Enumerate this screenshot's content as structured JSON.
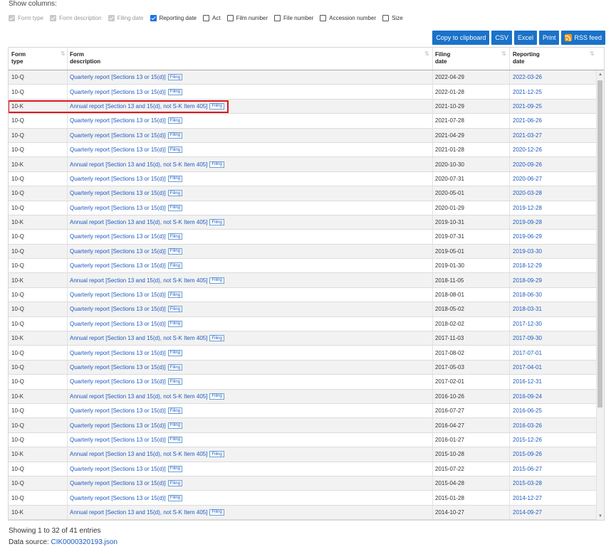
{
  "show_columns": {
    "title": "Show columns:",
    "options": [
      {
        "label": "Form type",
        "checked": true,
        "disabled": true
      },
      {
        "label": "Form description",
        "checked": true,
        "disabled": true
      },
      {
        "label": "Filing date",
        "checked": true,
        "disabled": true
      },
      {
        "label": "Reporting date",
        "checked": true,
        "disabled": false
      },
      {
        "label": "Act",
        "checked": false,
        "disabled": false
      },
      {
        "label": "Film number",
        "checked": false,
        "disabled": false
      },
      {
        "label": "File number",
        "checked": false,
        "disabled": false
      },
      {
        "label": "Accession number",
        "checked": false,
        "disabled": false
      },
      {
        "label": "Size",
        "checked": false,
        "disabled": false
      }
    ]
  },
  "toolbar": {
    "copy_label": "Copy to clipboard",
    "csv_label": "CSV",
    "excel_label": "Excel",
    "print_label": "Print",
    "rss_label": "RSS feed"
  },
  "table": {
    "headers": {
      "form_type": [
        "Form",
        "type"
      ],
      "form_description": [
        "Form",
        "description"
      ],
      "filing_date": [
        "Filing",
        "date"
      ],
      "reporting_date": [
        "Reporting",
        "date"
      ]
    },
    "filing_tag": "Filing",
    "highlighted_row_index": 2,
    "rows": [
      {
        "type": "10-Q",
        "desc": "Quarterly report [Sections 13 or 15(d)]",
        "filing_date": "2022-04-29",
        "reporting_date": "2022-03-26"
      },
      {
        "type": "10-Q",
        "desc": "Quarterly report [Sections 13 or 15(d)]",
        "filing_date": "2022-01-28",
        "reporting_date": "2021-12-25"
      },
      {
        "type": "10-K",
        "desc": "Annual report [Section 13 and 15(d), not S-K Item 405]",
        "filing_date": "2021-10-29",
        "reporting_date": "2021-09-25"
      },
      {
        "type": "10-Q",
        "desc": "Quarterly report [Sections 13 or 15(d)]",
        "filing_date": "2021-07-28",
        "reporting_date": "2021-06-26"
      },
      {
        "type": "10-Q",
        "desc": "Quarterly report [Sections 13 or 15(d)]",
        "filing_date": "2021-04-29",
        "reporting_date": "2021-03-27"
      },
      {
        "type": "10-Q",
        "desc": "Quarterly report [Sections 13 or 15(d)]",
        "filing_date": "2021-01-28",
        "reporting_date": "2020-12-26"
      },
      {
        "type": "10-K",
        "desc": "Annual report [Section 13 and 15(d), not S-K Item 405]",
        "filing_date": "2020-10-30",
        "reporting_date": "2020-09-26"
      },
      {
        "type": "10-Q",
        "desc": "Quarterly report [Sections 13 or 15(d)]",
        "filing_date": "2020-07-31",
        "reporting_date": "2020-06-27"
      },
      {
        "type": "10-Q",
        "desc": "Quarterly report [Sections 13 or 15(d)]",
        "filing_date": "2020-05-01",
        "reporting_date": "2020-03-28"
      },
      {
        "type": "10-Q",
        "desc": "Quarterly report [Sections 13 or 15(d)]",
        "filing_date": "2020-01-29",
        "reporting_date": "2019-12-28"
      },
      {
        "type": "10-K",
        "desc": "Annual report [Section 13 and 15(d), not S-K Item 405]",
        "filing_date": "2019-10-31",
        "reporting_date": "2019-09-28"
      },
      {
        "type": "10-Q",
        "desc": "Quarterly report [Sections 13 or 15(d)]",
        "filing_date": "2019-07-31",
        "reporting_date": "2019-06-29"
      },
      {
        "type": "10-Q",
        "desc": "Quarterly report [Sections 13 or 15(d)]",
        "filing_date": "2019-05-01",
        "reporting_date": "2019-03-30"
      },
      {
        "type": "10-Q",
        "desc": "Quarterly report [Sections 13 or 15(d)]",
        "filing_date": "2019-01-30",
        "reporting_date": "2018-12-29"
      },
      {
        "type": "10-K",
        "desc": "Annual report [Section 13 and 15(d), not S-K Item 405]",
        "filing_date": "2018-11-05",
        "reporting_date": "2018-09-29"
      },
      {
        "type": "10-Q",
        "desc": "Quarterly report [Sections 13 or 15(d)]",
        "filing_date": "2018-08-01",
        "reporting_date": "2018-06-30"
      },
      {
        "type": "10-Q",
        "desc": "Quarterly report [Sections 13 or 15(d)]",
        "filing_date": "2018-05-02",
        "reporting_date": "2018-03-31"
      },
      {
        "type": "10-Q",
        "desc": "Quarterly report [Sections 13 or 15(d)]",
        "filing_date": "2018-02-02",
        "reporting_date": "2017-12-30"
      },
      {
        "type": "10-K",
        "desc": "Annual report [Section 13 and 15(d), not S-K Item 405]",
        "filing_date": "2017-11-03",
        "reporting_date": "2017-09-30"
      },
      {
        "type": "10-Q",
        "desc": "Quarterly report [Sections 13 or 15(d)]",
        "filing_date": "2017-08-02",
        "reporting_date": "2017-07-01"
      },
      {
        "type": "10-Q",
        "desc": "Quarterly report [Sections 13 or 15(d)]",
        "filing_date": "2017-05-03",
        "reporting_date": "2017-04-01"
      },
      {
        "type": "10-Q",
        "desc": "Quarterly report [Sections 13 or 15(d)]",
        "filing_date": "2017-02-01",
        "reporting_date": "2016-12-31"
      },
      {
        "type": "10-K",
        "desc": "Annual report [Section 13 and 15(d), not S-K Item 405]",
        "filing_date": "2016-10-26",
        "reporting_date": "2016-09-24"
      },
      {
        "type": "10-Q",
        "desc": "Quarterly report [Sections 13 or 15(d)]",
        "filing_date": "2016-07-27",
        "reporting_date": "2016-06-25"
      },
      {
        "type": "10-Q",
        "desc": "Quarterly report [Sections 13 or 15(d)]",
        "filing_date": "2016-04-27",
        "reporting_date": "2016-03-26"
      },
      {
        "type": "10-Q",
        "desc": "Quarterly report [Sections 13 or 15(d)]",
        "filing_date": "2016-01-27",
        "reporting_date": "2015-12-26"
      },
      {
        "type": "10-K",
        "desc": "Annual report [Section 13 and 15(d), not S-K Item 405]",
        "filing_date": "2015-10-28",
        "reporting_date": "2015-09-26"
      },
      {
        "type": "10-Q",
        "desc": "Quarterly report [Sections 13 or 15(d)]",
        "filing_date": "2015-07-22",
        "reporting_date": "2015-06-27"
      },
      {
        "type": "10-Q",
        "desc": "Quarterly report [Sections 13 or 15(d)]",
        "filing_date": "2015-04-28",
        "reporting_date": "2015-03-28"
      },
      {
        "type": "10-Q",
        "desc": "Quarterly report [Sections 13 or 15(d)]",
        "filing_date": "2015-01-28",
        "reporting_date": "2014-12-27"
      },
      {
        "type": "10-K",
        "desc": "Annual report [Section 13 and 15(d), not S-K Item 405]",
        "filing_date": "2014-10-27",
        "reporting_date": "2014-09-27"
      }
    ]
  },
  "footer": {
    "showing_text": "Showing 1 to 32 of 41 entries",
    "data_source_label": "Data source: ",
    "data_source_link": "CIK0000320193.json"
  },
  "colors": {
    "button_bg": "#1a72c9",
    "link": "#1f5bbf",
    "highlight": "#e0161d",
    "rss": "#f39c12"
  }
}
